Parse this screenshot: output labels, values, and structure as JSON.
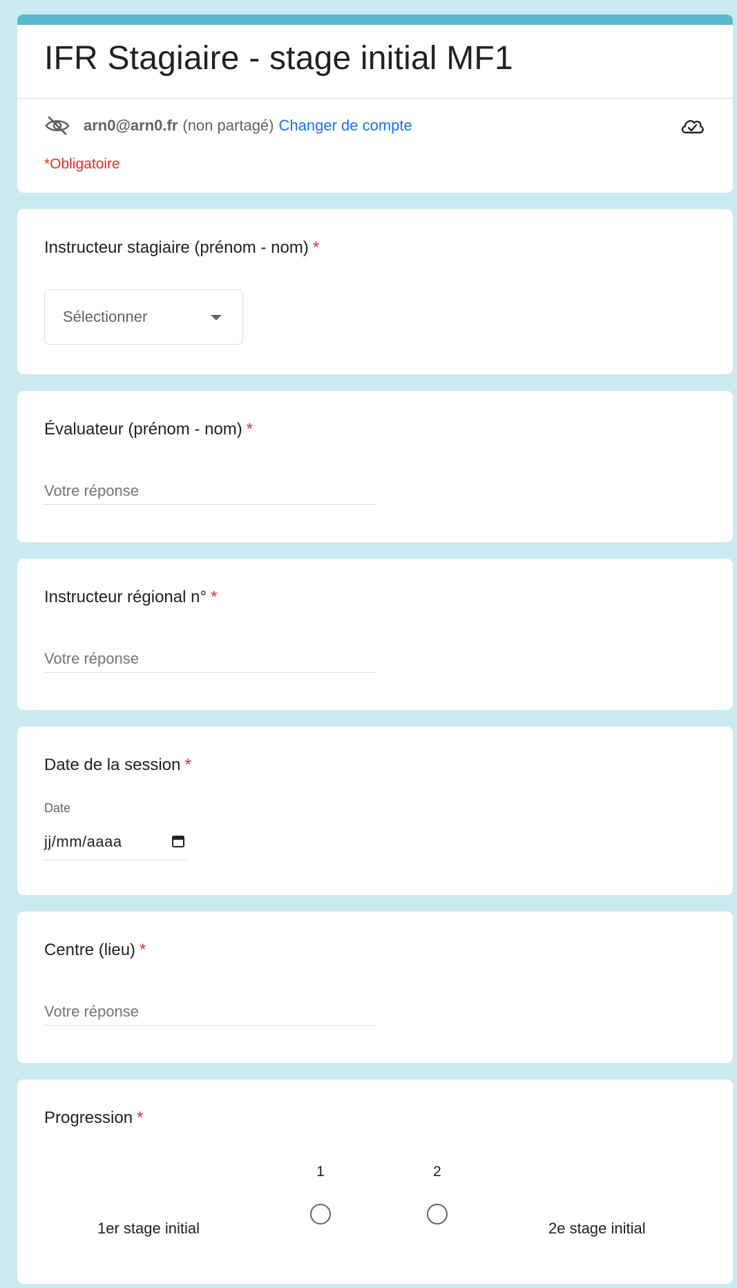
{
  "colors": {
    "page_background": "#c9eaf0",
    "accent": "#5ab8d0",
    "required": "#d93025",
    "link": "#1a73e8"
  },
  "header": {
    "title": "IFR Stagiaire - stage initial MF1",
    "account": {
      "icon": "eye-off-icon",
      "email": "arn0@arn0.fr",
      "status": "(non partagé)",
      "switch_label": "Changer de compte"
    },
    "save_status_icon": "cloud-check-icon",
    "required_note": "*Obligatoire"
  },
  "questions": {
    "trainee": {
      "title": "Instructeur stagiaire (prénom - nom)",
      "required_mark": "*",
      "select_value": "Sélectionner"
    },
    "evaluator": {
      "title": "Évaluateur (prénom - nom)",
      "required_mark": "*",
      "placeholder": "Votre réponse"
    },
    "regional": {
      "title": "Instructeur régional n°",
      "required_mark": "*",
      "placeholder": "Votre réponse"
    },
    "session_date": {
      "title": "Date de la session",
      "required_mark": "*",
      "sub_label": "Date",
      "value_placeholder": "jj/mm/aaaa",
      "icon": "calendar-icon"
    },
    "center": {
      "title": "Centre (lieu)",
      "required_mark": "*",
      "placeholder": "Votre réponse"
    },
    "progression": {
      "title": "Progression",
      "required_mark": "*",
      "low_label": "1er stage initial",
      "high_label": "2e stage initial",
      "scale": [
        "1",
        "2"
      ]
    }
  }
}
